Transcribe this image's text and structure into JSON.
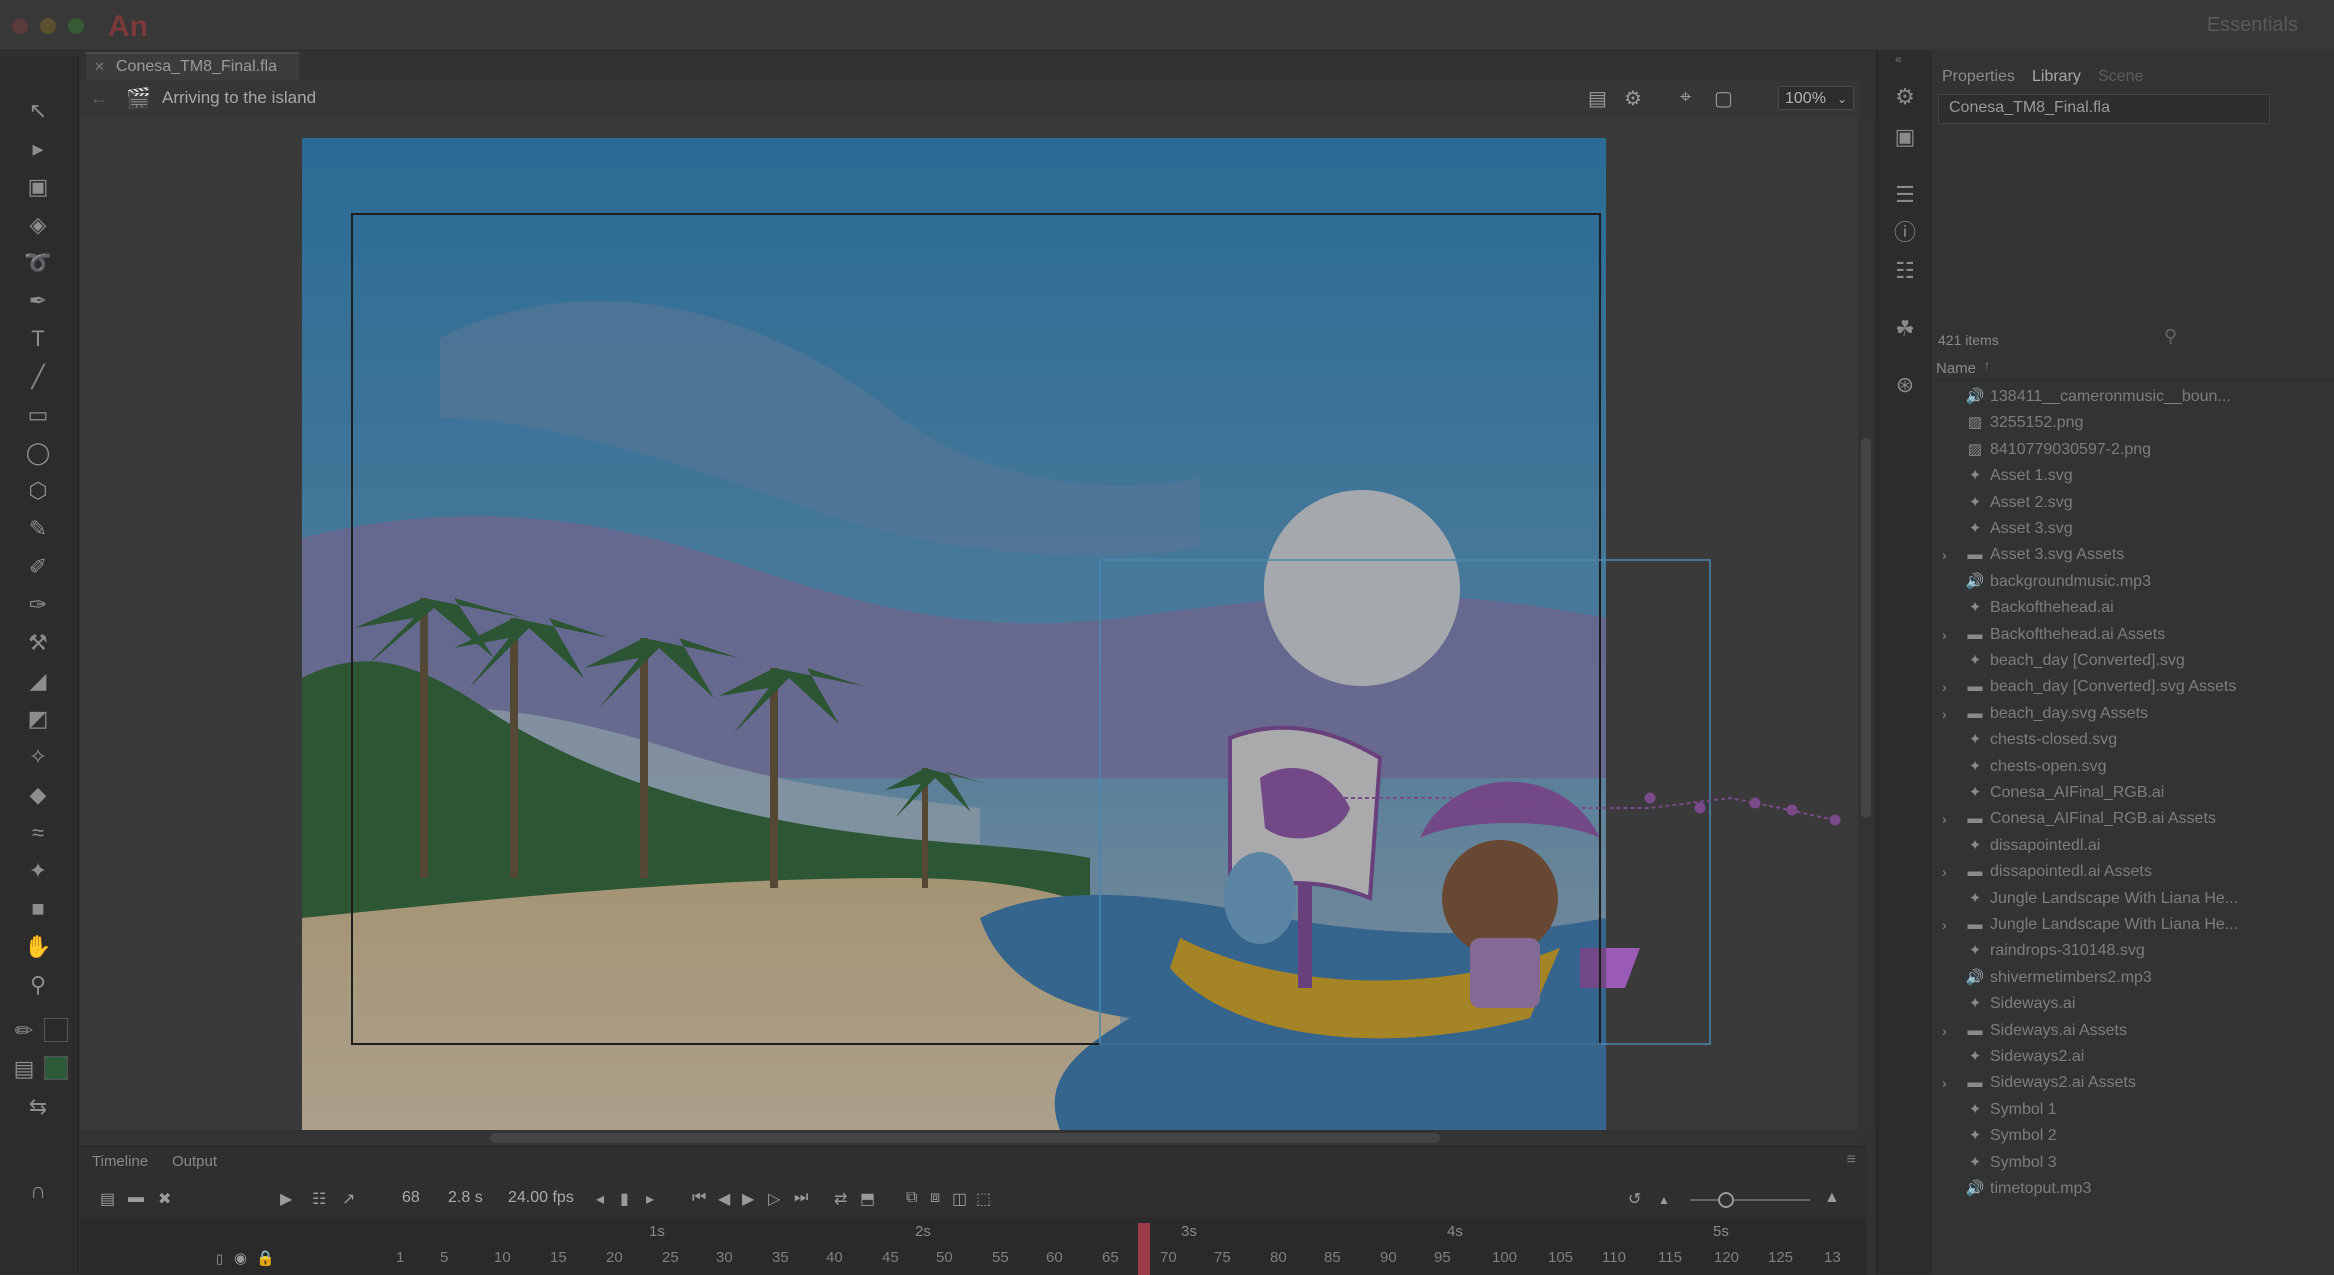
{
  "app": {
    "logo": "An",
    "workspace": "Essentials"
  },
  "document_tab": "Conesa_TM8_Final.fla",
  "scene": {
    "name": "Arriving to the island",
    "zoom": "100%"
  },
  "timeline": {
    "tabs": [
      "Timeline",
      "Output"
    ],
    "current_frame": "68",
    "time": "2.8 s",
    "fps": "24.00 fps",
    "seconds": [
      "1s",
      "2s",
      "3s",
      "4s",
      "5s"
    ],
    "frames": [
      "1",
      "5",
      "10",
      "15",
      "20",
      "25",
      "30",
      "35",
      "40",
      "45",
      "50",
      "55",
      "60",
      "65",
      "70",
      "75",
      "80",
      "85",
      "90",
      "95",
      "100",
      "105",
      "110",
      "115",
      "120",
      "125",
      "13"
    ]
  },
  "library": {
    "tabs": [
      "Properties",
      "Library",
      "Scene"
    ],
    "document": "Conesa_TM8_Final.fla",
    "count": "421 items",
    "column_name": "Name",
    "items": [
      {
        "name": "138411__cameronmusic__boun...",
        "icon": "sound-icon",
        "folder": false
      },
      {
        "name": "3255152.png",
        "icon": "bitmap-icon",
        "folder": false
      },
      {
        "name": "8410779030597-2.png",
        "icon": "bitmap-icon",
        "folder": false
      },
      {
        "name": "Asset 1.svg",
        "icon": "graphic-icon",
        "folder": false
      },
      {
        "name": "Asset 2.svg",
        "icon": "graphic-icon",
        "folder": false
      },
      {
        "name": "Asset 3.svg",
        "icon": "graphic-icon",
        "folder": false
      },
      {
        "name": "Asset 3.svg Assets",
        "icon": "folder-icon",
        "folder": true
      },
      {
        "name": "backgroundmusic.mp3",
        "icon": "sound-icon",
        "folder": false
      },
      {
        "name": "Backofthehead.ai",
        "icon": "graphic-icon",
        "folder": false
      },
      {
        "name": "Backofthehead.ai Assets",
        "icon": "folder-icon",
        "folder": true
      },
      {
        "name": "beach_day [Converted].svg",
        "icon": "graphic-icon",
        "folder": false
      },
      {
        "name": "beach_day [Converted].svg Assets",
        "icon": "folder-icon",
        "folder": true
      },
      {
        "name": "beach_day.svg Assets",
        "icon": "folder-icon",
        "folder": true
      },
      {
        "name": "chests-closed.svg",
        "icon": "graphic-icon",
        "folder": false
      },
      {
        "name": "chests-open.svg",
        "icon": "graphic-icon",
        "folder": false
      },
      {
        "name": "Conesa_AIFinal_RGB.ai",
        "icon": "graphic-icon",
        "folder": false
      },
      {
        "name": "Conesa_AIFinal_RGB.ai Assets",
        "icon": "folder-icon",
        "folder": true
      },
      {
        "name": "dissapointedl.ai",
        "icon": "graphic-icon",
        "folder": false
      },
      {
        "name": "dissapointedl.ai Assets",
        "icon": "folder-icon",
        "folder": true
      },
      {
        "name": "Jungle Landscape With Liana He...",
        "icon": "graphic-icon",
        "folder": false
      },
      {
        "name": "Jungle Landscape With Liana He...",
        "icon": "folder-icon",
        "folder": true
      },
      {
        "name": "raindrops-310148.svg",
        "icon": "graphic-icon",
        "folder": false
      },
      {
        "name": "shivermetimbers2.mp3",
        "icon": "sound-icon",
        "folder": false
      },
      {
        "name": "Sideways.ai",
        "icon": "graphic-icon",
        "folder": false
      },
      {
        "name": "Sideways.ai Assets",
        "icon": "folder-icon",
        "folder": true
      },
      {
        "name": "Sideways2.ai",
        "icon": "graphic-icon",
        "folder": false
      },
      {
        "name": "Sideways2.ai Assets",
        "icon": "folder-icon",
        "folder": true
      },
      {
        "name": "Symbol 1",
        "icon": "graphic-icon",
        "folder": false
      },
      {
        "name": "Symbol 2",
        "icon": "graphic-icon",
        "folder": false
      },
      {
        "name": "Symbol 3",
        "icon": "graphic-icon",
        "folder": false
      },
      {
        "name": "timetoput.mp3",
        "icon": "sound-icon",
        "folder": false
      }
    ]
  }
}
